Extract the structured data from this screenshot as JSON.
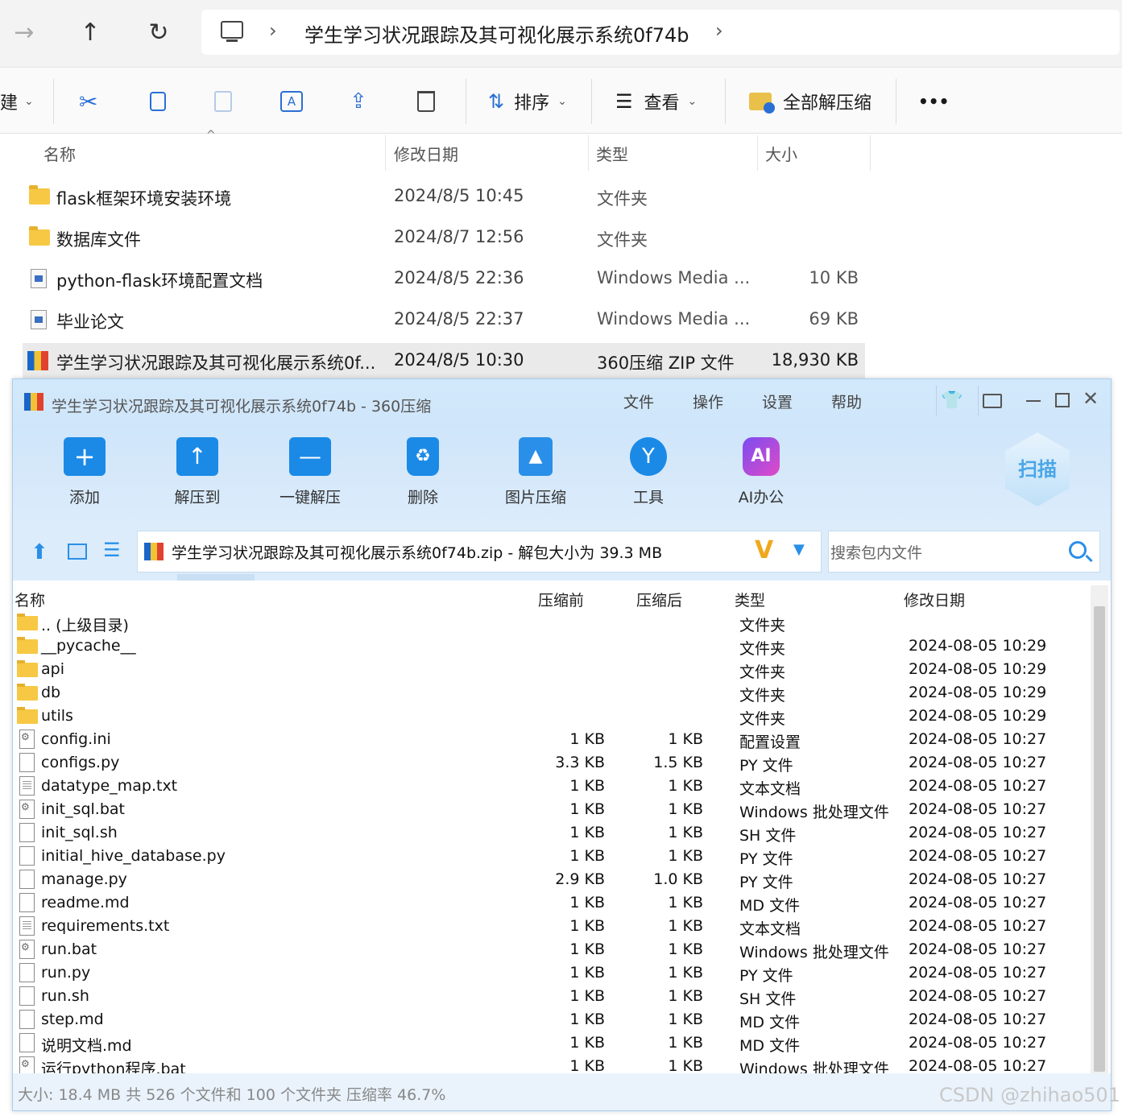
{
  "explorer": {
    "nav_back": "→",
    "nav_up": "↑",
    "nav_refresh": "↻",
    "breadcrumb_sep": "›",
    "breadcrumb_folder": "学生学习状况跟踪及其可视化展示系统0f74b",
    "breadcrumb_end": "›",
    "cmd_new_partial": "建",
    "cmd_sort": "排序",
    "cmd_view": "查看",
    "cmd_extract_all": "全部解压缩",
    "cmd_more": "•••",
    "columns": {
      "name": "名称",
      "modified": "修改日期",
      "type": "类型",
      "size": "大小"
    },
    "rows": [
      {
        "name": "flask框架环境安装环境",
        "date": "2024/8/5 10:45",
        "type": "文件夹",
        "size": ""
      },
      {
        "name": "数据库文件",
        "date": "2024/8/7 12:56",
        "type": "文件夹",
        "size": ""
      },
      {
        "name": "python-flask环境配置文档",
        "date": "2024/8/5 22:36",
        "type": "Windows Media ...",
        "size": "10 KB"
      },
      {
        "name": "毕业论文",
        "date": "2024/8/5 22:37",
        "type": "Windows Media ...",
        "size": "69 KB"
      },
      {
        "name": "学生学习状况跟踪及其可视化展示系统0f...",
        "date": "2024/8/5 10:30",
        "type": "360压缩 ZIP 文件",
        "size": "18,930 KB"
      }
    ]
  },
  "zipwin": {
    "title": "学生学习状况跟踪及其可视化展示系统0f74b - 360压缩",
    "menu": [
      "文件",
      "操作",
      "设置",
      "帮助"
    ],
    "tools": [
      "添加",
      "解压到",
      "一键解压",
      "删除",
      "图片压缩",
      "工具",
      "AI办公"
    ],
    "scan_label": "扫描",
    "path_text": "学生学习状况跟踪及其可视化展示系统0f74b.zip - 解包大小为 39.3 MB",
    "search_placeholder": "搜索包内文件",
    "columns": {
      "name": "名称",
      "before": "压缩前",
      "after": "压缩后",
      "type": "类型",
      "date": "修改日期"
    },
    "rows": [
      {
        "icon": "folder",
        "name": ".. (上级目录)",
        "before": "",
        "after": "",
        "type": "文件夹",
        "date": ""
      },
      {
        "icon": "folder",
        "name": "__pycache__",
        "before": "",
        "after": "",
        "type": "文件夹",
        "date": "2024-08-05 10:29"
      },
      {
        "icon": "folder",
        "name": "api",
        "before": "",
        "after": "",
        "type": "文件夹",
        "date": "2024-08-05 10:29"
      },
      {
        "icon": "folder",
        "name": "db",
        "before": "",
        "after": "",
        "type": "文件夹",
        "date": "2024-08-05 10:29"
      },
      {
        "icon": "folder",
        "name": "utils",
        "before": "",
        "after": "",
        "type": "文件夹",
        "date": "2024-08-05 10:29"
      },
      {
        "icon": "gear",
        "name": "config.ini",
        "before": "1 KB",
        "after": "1 KB",
        "type": "配置设置",
        "date": "2024-08-05 10:27"
      },
      {
        "icon": "file",
        "name": "configs.py",
        "before": "3.3 KB",
        "after": "1.5 KB",
        "type": "PY 文件",
        "date": "2024-08-05 10:27"
      },
      {
        "icon": "txt",
        "name": "datatype_map.txt",
        "before": "1 KB",
        "after": "1 KB",
        "type": "文本文档",
        "date": "2024-08-05 10:27"
      },
      {
        "icon": "gear",
        "name": "init_sql.bat",
        "before": "1 KB",
        "after": "1 KB",
        "type": "Windows 批处理文件",
        "date": "2024-08-05 10:27"
      },
      {
        "icon": "file",
        "name": "init_sql.sh",
        "before": "1 KB",
        "after": "1 KB",
        "type": "SH 文件",
        "date": "2024-08-05 10:27"
      },
      {
        "icon": "file",
        "name": "initial_hive_database.py",
        "before": "1 KB",
        "after": "1 KB",
        "type": "PY 文件",
        "date": "2024-08-05 10:27"
      },
      {
        "icon": "file",
        "name": "manage.py",
        "before": "2.9 KB",
        "after": "1.0 KB",
        "type": "PY 文件",
        "date": "2024-08-05 10:27"
      },
      {
        "icon": "file",
        "name": "readme.md",
        "before": "1 KB",
        "after": "1 KB",
        "type": "MD 文件",
        "date": "2024-08-05 10:27"
      },
      {
        "icon": "txt",
        "name": "requirements.txt",
        "before": "1 KB",
        "after": "1 KB",
        "type": "文本文档",
        "date": "2024-08-05 10:27"
      },
      {
        "icon": "gear",
        "name": "run.bat",
        "before": "1 KB",
        "after": "1 KB",
        "type": "Windows 批处理文件",
        "date": "2024-08-05 10:27"
      },
      {
        "icon": "file",
        "name": "run.py",
        "before": "1 KB",
        "after": "1 KB",
        "type": "PY 文件",
        "date": "2024-08-05 10:27"
      },
      {
        "icon": "file",
        "name": "run.sh",
        "before": "1 KB",
        "after": "1 KB",
        "type": "SH 文件",
        "date": "2024-08-05 10:27"
      },
      {
        "icon": "file",
        "name": "step.md",
        "before": "1 KB",
        "after": "1 KB",
        "type": "MD 文件",
        "date": "2024-08-05 10:27"
      },
      {
        "icon": "file",
        "name": "说明文档.md",
        "before": "1 KB",
        "after": "1 KB",
        "type": "MD 文件",
        "date": "2024-08-05 10:27"
      },
      {
        "icon": "gear",
        "name": "运行python程序.bat",
        "before": "1 KB",
        "after": "1 KB",
        "type": "Windows 批处理文件",
        "date": "2024-08-05 10:27"
      }
    ],
    "status": "大小: 18.4 MB 共 526 个文件和 100 个文件夹 压缩率 46.7%"
  },
  "watermark": "CSDN @zhihao501",
  "colors": {
    "zip_chrome": "#d2e8fb",
    "selected_row": "#eaeaea",
    "accent_blue": "#1a8ae6"
  }
}
